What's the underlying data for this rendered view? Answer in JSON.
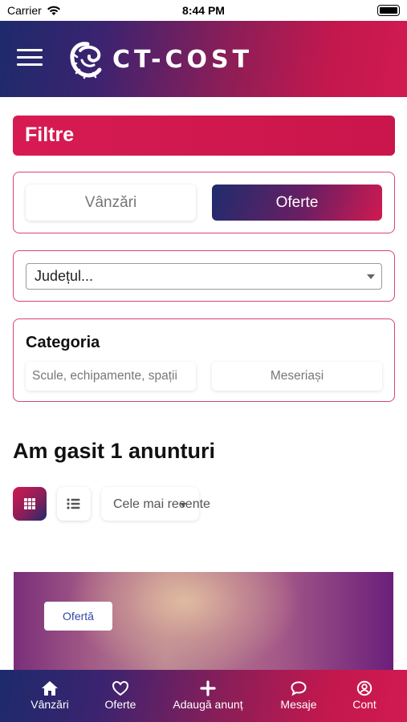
{
  "status_bar": {
    "carrier": "Carrier",
    "time": "8:44 PM"
  },
  "header": {
    "logo_text": "CT-COST",
    "menu_icon": "hamburger-icon"
  },
  "filters": {
    "title": "Filtre",
    "type_toggle": {
      "options": [
        "Vânzări",
        "Oferte"
      ],
      "selected": "Oferte"
    },
    "county_select": {
      "value": "Județul..."
    },
    "category": {
      "title": "Categoria",
      "options": [
        "Scule, echipamente, spații",
        "Meseriași"
      ]
    }
  },
  "results": {
    "title": "Am gasit 1 anunturi",
    "view_modes": [
      "grid-icon",
      "list-icon"
    ],
    "active_view": "grid",
    "sort_value": "Cele mai recente"
  },
  "listing": {
    "badge": "Ofertă"
  },
  "tab_bar": {
    "items": [
      {
        "label": "Vânzări",
        "icon": "home-icon"
      },
      {
        "label": "Oferte",
        "icon": "heart-icon"
      },
      {
        "label": "Adaugă anunț",
        "icon": "plus-icon"
      },
      {
        "label": "Mesaje",
        "icon": "chat-icon"
      },
      {
        "label": "Cont",
        "icon": "user-circle-icon"
      }
    ]
  },
  "colors": {
    "brand_red": "#d11a50",
    "brand_blue": "#1e2c6e",
    "card_border": "#d9456f"
  }
}
